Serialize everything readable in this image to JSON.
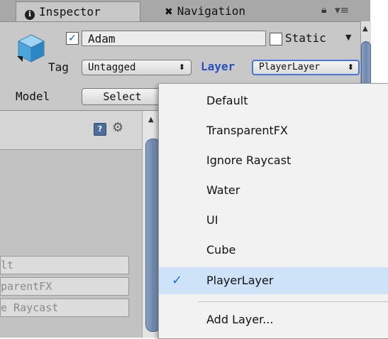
{
  "tabs": {
    "inspector": "Inspector",
    "navigation": "Navigation"
  },
  "object": {
    "name": "Adam",
    "static_label": "Static",
    "tag_label": "Tag",
    "tag_value": "Untagged",
    "layer_label": "Layer",
    "layer_value": "PlayerLayer",
    "model_label": "Model",
    "select_button": "Select"
  },
  "dropdown": {
    "items": [
      "Default",
      "TransparentFX",
      "Ignore Raycast",
      "Water",
      "UI",
      "Cube",
      "PlayerLayer"
    ],
    "selected": "PlayerLayer",
    "add_layer": "Add Layer..."
  },
  "background_list": {
    "items": [
      "lt",
      "parentFX",
      "e Raycast"
    ]
  },
  "icons": {
    "info": "info-icon",
    "navigation": "navigation-icon",
    "lock": "lock-icon",
    "menu": "menu-icon",
    "help": "help-icon",
    "gear": "gear-icon",
    "check": "checkmark-icon"
  },
  "colors": {
    "layer_accent": "#2b4fc0",
    "selection": "#cfe3f8",
    "panel": "#c8c8c8"
  }
}
